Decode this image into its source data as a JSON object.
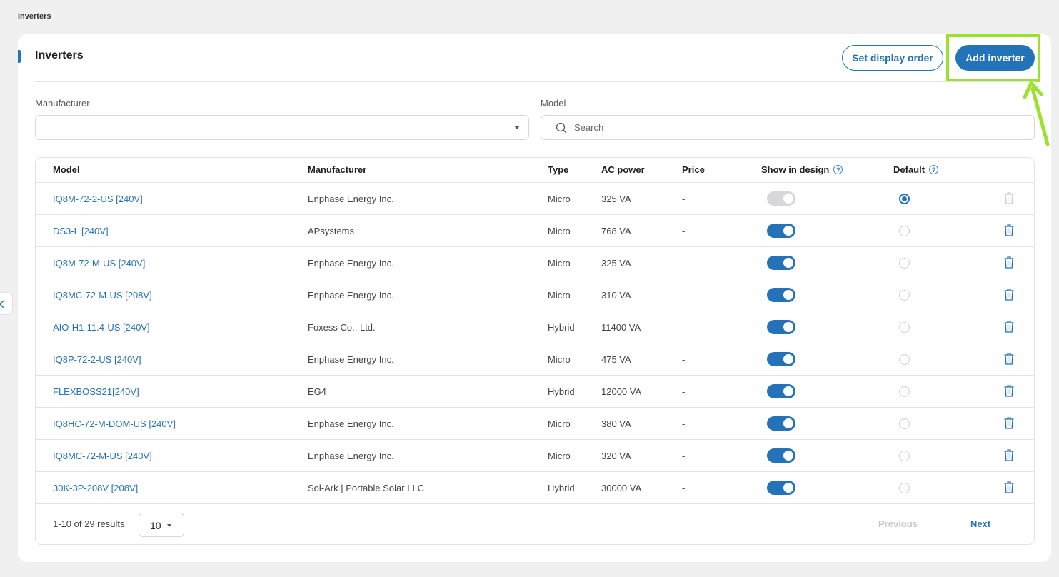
{
  "breadcrumb": "Inverters",
  "header": {
    "title": "Inverters",
    "set_display_order_label": "Set display order",
    "add_inverter_label": "Add inverter"
  },
  "filters": {
    "manufacturer_label": "Manufacturer",
    "manufacturer_value": "",
    "model_label": "Model",
    "model_placeholder": "Search"
  },
  "table": {
    "columns": {
      "model": "Model",
      "manufacturer": "Manufacturer",
      "type": "Type",
      "ac_power": "AC power",
      "price": "Price",
      "show_in_design": "Show in design",
      "default": "Default"
    },
    "rows": [
      {
        "model": "IQ8M-72-2-US [240V]",
        "manufacturer": "Enphase Energy Inc.",
        "type": "Micro",
        "ac_power": "325 VA",
        "price": "-",
        "show_in_design": true,
        "show_disabled": true,
        "default": true,
        "delete_disabled": true
      },
      {
        "model": "DS3-L [240V]",
        "manufacturer": "APsystems",
        "type": "Micro",
        "ac_power": "768 VA",
        "price": "-",
        "show_in_design": true,
        "show_disabled": false,
        "default": false,
        "delete_disabled": false
      },
      {
        "model": "IQ8M-72-M-US [240V]",
        "manufacturer": "Enphase Energy Inc.",
        "type": "Micro",
        "ac_power": "325 VA",
        "price": "-",
        "show_in_design": true,
        "show_disabled": false,
        "default": false,
        "delete_disabled": false
      },
      {
        "model": "IQ8MC-72-M-US [208V]",
        "manufacturer": "Enphase Energy Inc.",
        "type": "Micro",
        "ac_power": "310 VA",
        "price": "-",
        "show_in_design": true,
        "show_disabled": false,
        "default": false,
        "delete_disabled": false
      },
      {
        "model": "AIO-H1-11.4-US [240V]",
        "manufacturer": "Foxess Co., Ltd.",
        "type": "Hybrid",
        "ac_power": "11400 VA",
        "price": "-",
        "show_in_design": true,
        "show_disabled": false,
        "default": false,
        "delete_disabled": false
      },
      {
        "model": "IQ8P-72-2-US [240V]",
        "manufacturer": "Enphase Energy Inc.",
        "type": "Micro",
        "ac_power": "475 VA",
        "price": "-",
        "show_in_design": true,
        "show_disabled": false,
        "default": false,
        "delete_disabled": false
      },
      {
        "model": "FLEXBOSS21[240V]",
        "manufacturer": "EG4",
        "type": "Hybrid",
        "ac_power": "12000 VA",
        "price": "-",
        "show_in_design": true,
        "show_disabled": false,
        "default": false,
        "delete_disabled": false
      },
      {
        "model": "IQ8HC-72-M-DOM-US [240V]",
        "manufacturer": "Enphase Energy Inc.",
        "type": "Micro",
        "ac_power": "380 VA",
        "price": "-",
        "show_in_design": true,
        "show_disabled": false,
        "default": false,
        "delete_disabled": false
      },
      {
        "model": "IQ8MC-72-M-US [240V]",
        "manufacturer": "Enphase Energy Inc.",
        "type": "Micro",
        "ac_power": "320 VA",
        "price": "-",
        "show_in_design": true,
        "show_disabled": false,
        "default": false,
        "delete_disabled": false
      },
      {
        "model": "30K-3P-208V [208V]",
        "manufacturer": "Sol-Ark | Portable Solar LLC",
        "type": "Hybrid",
        "ac_power": "30000 VA",
        "price": "-",
        "show_in_design": true,
        "show_disabled": false,
        "default": false,
        "delete_disabled": false
      }
    ]
  },
  "pagination": {
    "results_text": "1-10 of 29 results",
    "page_size": "10",
    "previous_label": "Previous",
    "next_label": "Next"
  },
  "icons": {
    "search": "search-icon",
    "help": "help-circle-icon",
    "trash": "trash-icon",
    "chevron": "chevron-left-icon",
    "caret": "caret-down-icon"
  },
  "colors": {
    "accent": "#2472b8",
    "highlight": "#9be22c",
    "background": "#f0f0f1"
  }
}
